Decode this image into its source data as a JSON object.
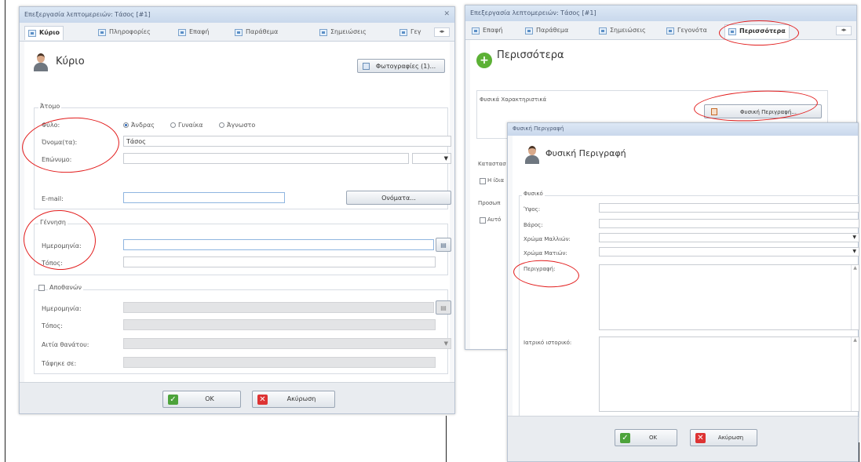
{
  "left_window": {
    "title": "Επεξεργασία λεπτομερειών: Τάσος [#1]",
    "tabs": [
      "Κύριο",
      "Πληροφορίες",
      "Επαφή",
      "Παράθεμα",
      "Σημειώσεις",
      "Γεγ"
    ],
    "header_title": "Κύριο",
    "photos_button": "Φωτογραφίες (1)...",
    "person_group": {
      "legend": "Άτομο",
      "gender_label": "Φύλο:",
      "gender_options": [
        "Άνδρας",
        "Γυναίκα",
        "Άγνωστο"
      ],
      "gender_selected": "Άνδρας",
      "names_label": "Όνομα(τα):",
      "names_value": "Τάσος",
      "surname_label": "Επώνυμο:",
      "surname_value": "",
      "email_label": "E-mail:",
      "email_value": "",
      "names_button": "Ονόματα..."
    },
    "birth_group": {
      "legend": "Γέννηση",
      "date_label": "Ημερομηνία:",
      "date_value": "",
      "place_label": "Τόπος:",
      "place_value": ""
    },
    "death_group": {
      "legend": "Αποθανών",
      "checked": false,
      "date_label": "Ημερομηνία:",
      "place_label": "Τόπος:",
      "cause_label": "Αιτία θανάτου:",
      "buried_label": "Τάφηκε σε:"
    },
    "ok_label": "OK",
    "cancel_label": "Ακύρωση"
  },
  "right_window": {
    "title": "Επεξεργασία λεπτομερειών: Τάσος [#1]",
    "tabs": [
      "Επαφή",
      "Παράθεμα",
      "Σημειώσεις",
      "Γεγονότα",
      "Περισσότερα"
    ],
    "header_title": "Περισσότερα",
    "physical_group_legend": "Φυσικά Χαρακτηριστικά",
    "physical_desc_button": "Φυσική Περιγραφή...",
    "partial_labels": [
      "Καταστασ",
      "Η ίδια",
      "Προσωπ",
      "Αυτό"
    ]
  },
  "dialog": {
    "title": "Φυσική Περιγραφή",
    "header_title": "Φυσική Περιγραφή",
    "group_legend": "Φυσικό",
    "height_label": "Ύψος:",
    "weight_label": "Βάρος:",
    "hair_color_label": "Χρώμα Μαλλιών:",
    "eye_color_label": "Χρώμα Ματιών:",
    "description_label": "Περιγραφή:",
    "medical_history_label": "Ιατρικό ιστορικό:",
    "ok_label": "OK",
    "cancel_label": "Ακύρωση"
  },
  "colors": {
    "annotation_red": "#e21b1b",
    "ok_green": "#4da33b",
    "cancel_red": "#dd3333"
  }
}
